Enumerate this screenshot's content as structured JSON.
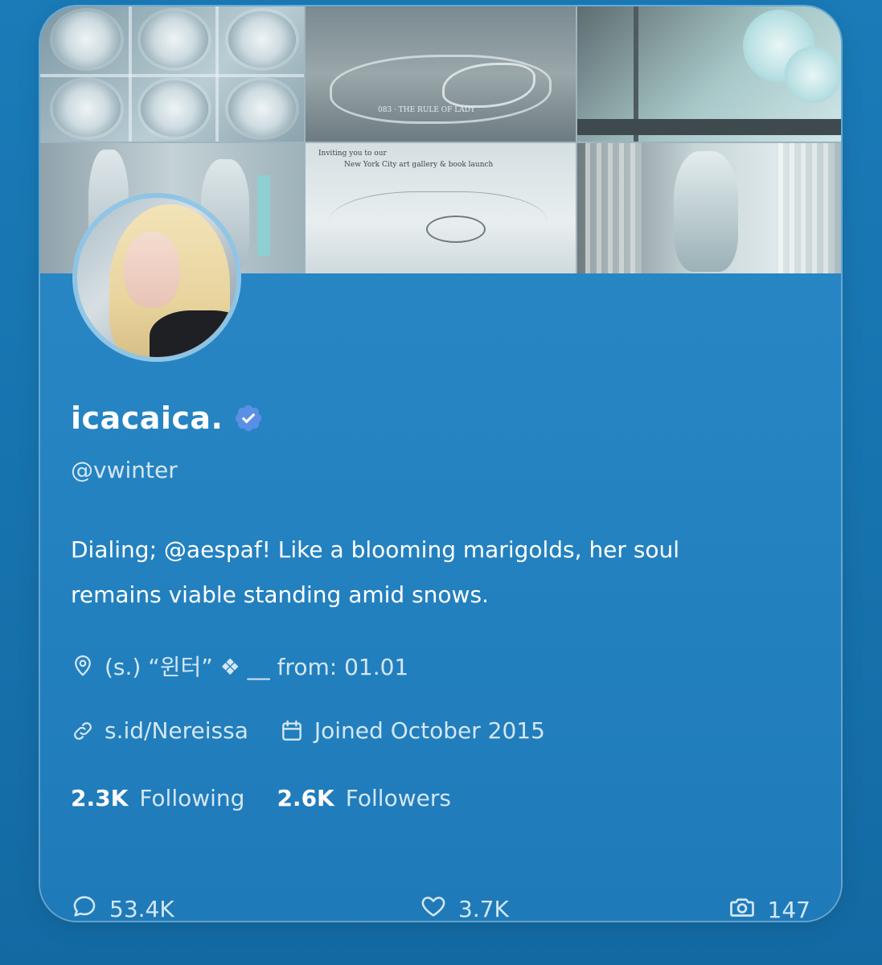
{
  "profile": {
    "display_name": "icacaica.",
    "handle": "@vwinter",
    "bio_line1": "Dialing; @aespaf! Like a blooming marigolds, her soul",
    "bio_line2": "remains viable standing amid snows.",
    "location": "(s.) “윈터” ❖ __ from: 01.01",
    "website": "s.id/Nereissa",
    "joined": "Joined October 2015",
    "verified": true
  },
  "stats": {
    "following_count": "2.3K",
    "following_label": "Following",
    "followers_count": "2.6K",
    "followers_label": "Followers"
  },
  "actions": {
    "replies": "53.4K",
    "likes": "3.7K",
    "media": "147"
  },
  "banner": {
    "text_1": "083 · THE RULE OF LADY",
    "text_2": "Inviting you to our",
    "text_3": "New York City art gallery & book launch"
  },
  "icons": [
    "location-pin-icon",
    "link-icon",
    "calendar-icon",
    "verified-badge-icon",
    "reply-icon",
    "heart-icon",
    "camera-icon"
  ],
  "colors": {
    "background": "#1773ae",
    "card": "#2583c1",
    "verified": "#5a8fe6",
    "text_primary": "#ffffff",
    "text_secondary": "#d3e7f4"
  }
}
